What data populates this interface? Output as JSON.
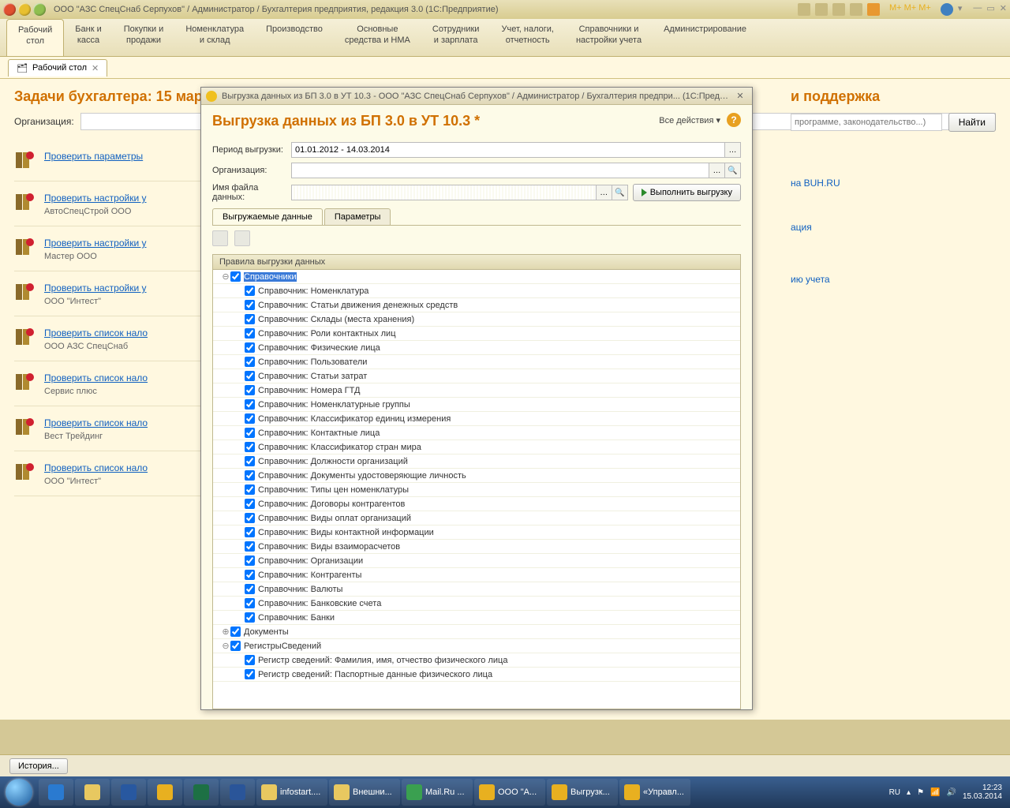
{
  "titlebar": {
    "text": "ООО \"АЗС СпецСнаб Серпухов\" / Администратор / Бухгалтерия предприятия, редакция 3.0  (1С:Предприятие)"
  },
  "mainnav": [
    {
      "l1": "Рабочий",
      "l2": "стол"
    },
    {
      "l1": "Банк и",
      "l2": "касса"
    },
    {
      "l1": "Покупки и",
      "l2": "продажи"
    },
    {
      "l1": "Номенклатура",
      "l2": "и склад"
    },
    {
      "l1": "Производство",
      "l2": ""
    },
    {
      "l1": "Основные",
      "l2": "средства и НМА"
    },
    {
      "l1": "Сотрудники",
      "l2": "и зарплата"
    },
    {
      "l1": "Учет, налоги,",
      "l2": "отчетность"
    },
    {
      "l1": "Справочники и",
      "l2": "настройки учета"
    },
    {
      "l1": "Администрирование",
      "l2": ""
    }
  ],
  "doctab": {
    "label": "Рабочий стол"
  },
  "left": {
    "title": "Задачи бухгалтера: 15 мар",
    "org_label": "Организация:",
    "tasks": [
      {
        "link": "Проверить параметры",
        "sub": ""
      },
      {
        "link": "Проверить настройки у",
        "sub": "АвтоСпецСтрой ООО"
      },
      {
        "link": "Проверить настройки у",
        "sub": "Мастер ООО"
      },
      {
        "link": "Проверить настройки у",
        "sub": "ООО \"Интест\""
      },
      {
        "link": "Проверить список нало",
        "sub": "ООО АЗС СпецСнаб"
      },
      {
        "link": "Проверить список нало",
        "sub": "Сервис плюс"
      },
      {
        "link": "Проверить список нало",
        "sub": "Вест Трейдинг"
      },
      {
        "link": "Проверить список нало",
        "sub": "ООО \"Интест\""
      }
    ]
  },
  "right": {
    "title": "и поддержка",
    "placeholder": "программе, законодательство...)",
    "find": "Найти",
    "links": [
      "на BUH.RU",
      "ация",
      "ию учета"
    ]
  },
  "modal": {
    "titlebar": "Выгрузка данных из БП 3.0 в УТ 10.3 - ООО \"АЗС СпецСнаб Серпухов\" / Администратор / Бухгалтерия предпри...  (1С:Предприятие)",
    "h1": "Выгрузка данных из БП 3.0 в УТ 10.3 *",
    "all_actions": "Все действия ▾",
    "rows": {
      "period_label": "Период выгрузки:",
      "period_value": "01.01.2012 - 14.03.2014",
      "org_label": "Организация:",
      "file_label": "Имя файла данных:",
      "exec": "Выполнить выгрузку"
    },
    "subtabs": [
      "Выгружаемые данные",
      "Параметры"
    ],
    "tree_header": "Правила выгрузки данных",
    "tree": [
      {
        "level": 0,
        "exp": "⊖",
        "checked": true,
        "label": "Справочники",
        "selected": true
      },
      {
        "level": 1,
        "exp": "",
        "checked": true,
        "label": "Справочник: Номенклатура"
      },
      {
        "level": 1,
        "exp": "",
        "checked": true,
        "label": "Справочник: Статьи движения денежных средств"
      },
      {
        "level": 1,
        "exp": "",
        "checked": true,
        "label": "Справочник: Склады (места хранения)"
      },
      {
        "level": 1,
        "exp": "",
        "checked": true,
        "label": "Справочник: Роли контактных лиц"
      },
      {
        "level": 1,
        "exp": "",
        "checked": true,
        "label": "Справочник: Физические лица"
      },
      {
        "level": 1,
        "exp": "",
        "checked": true,
        "label": "Справочник: Пользователи"
      },
      {
        "level": 1,
        "exp": "",
        "checked": true,
        "label": "Справочник: Статьи затрат"
      },
      {
        "level": 1,
        "exp": "",
        "checked": true,
        "label": "Справочник: Номера ГТД"
      },
      {
        "level": 1,
        "exp": "",
        "checked": true,
        "label": "Справочник: Номенклатурные группы"
      },
      {
        "level": 1,
        "exp": "",
        "checked": true,
        "label": "Справочник: Классификатор единиц измерения"
      },
      {
        "level": 1,
        "exp": "",
        "checked": true,
        "label": "Справочник: Контактные лица"
      },
      {
        "level": 1,
        "exp": "",
        "checked": true,
        "label": "Справочник: Классификатор стран мира"
      },
      {
        "level": 1,
        "exp": "",
        "checked": true,
        "label": "Справочник: Должности организаций"
      },
      {
        "level": 1,
        "exp": "",
        "checked": true,
        "label": "Справочник: Документы удостоверяющие личность"
      },
      {
        "level": 1,
        "exp": "",
        "checked": true,
        "label": "Справочник: Типы цен номенклатуры"
      },
      {
        "level": 1,
        "exp": "",
        "checked": true,
        "label": "Справочник: Договоры контрагентов"
      },
      {
        "level": 1,
        "exp": "",
        "checked": true,
        "label": "Справочник: Виды оплат организаций"
      },
      {
        "level": 1,
        "exp": "",
        "checked": true,
        "label": "Справочник: Виды контактной информации"
      },
      {
        "level": 1,
        "exp": "",
        "checked": true,
        "label": "Справочник: Виды взаиморасчетов"
      },
      {
        "level": 1,
        "exp": "",
        "checked": true,
        "label": "Справочник: Организации"
      },
      {
        "level": 1,
        "exp": "",
        "checked": true,
        "label": "Справочник: Контрагенты"
      },
      {
        "level": 1,
        "exp": "",
        "checked": true,
        "label": "Справочник: Валюты"
      },
      {
        "level": 1,
        "exp": "",
        "checked": true,
        "label": "Справочник: Банковские счета"
      },
      {
        "level": 1,
        "exp": "",
        "checked": true,
        "label": "Справочник: Банки"
      },
      {
        "level": 0,
        "exp": "⊕",
        "checked": true,
        "label": "Документы"
      },
      {
        "level": 0,
        "exp": "⊖",
        "checked": true,
        "label": "РегистрыСведений"
      },
      {
        "level": 1,
        "exp": "",
        "checked": true,
        "label": "Регистр сведений: Фамилия, имя, отчество физического лица"
      },
      {
        "level": 1,
        "exp": "",
        "checked": true,
        "label": "Регистр сведений: Паспортные данные физического лица"
      }
    ]
  },
  "statusbar": {
    "history": "История..."
  },
  "taskbar": {
    "items": [
      "infostart....",
      "Внешни...",
      "Mail.Ru ...",
      "ООО \"А...",
      "Выгрузк...",
      "«Управл..."
    ],
    "lang": "RU",
    "time": "12:23",
    "date": "15.03.2014"
  }
}
